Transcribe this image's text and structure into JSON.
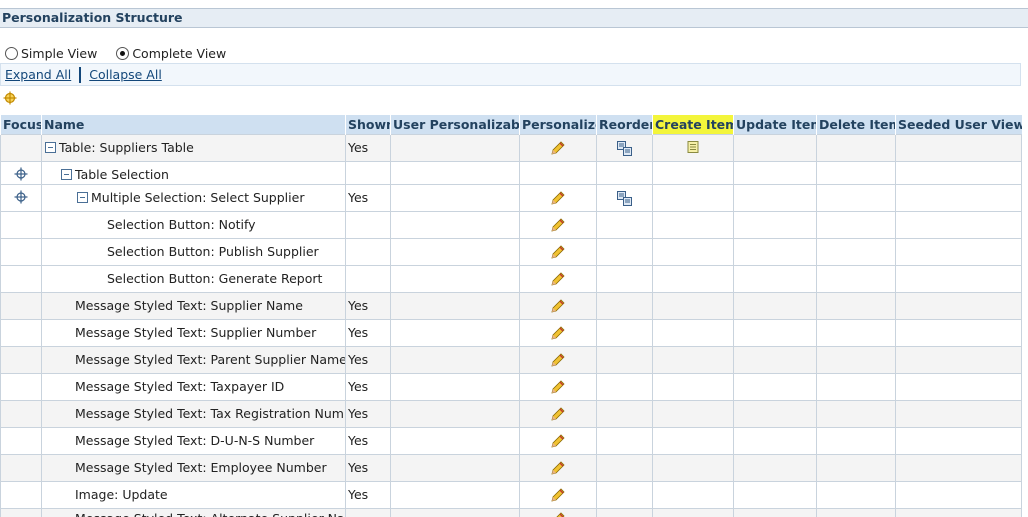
{
  "header": {
    "title": "Personalization Structure"
  },
  "view_options": {
    "simple_label": "Simple View",
    "complete_label": "Complete View",
    "selected": "Complete View"
  },
  "expand": {
    "expand_all": "Expand All",
    "collapse_all": "Collapse All"
  },
  "columns": {
    "focus": "Focus",
    "name": "Name",
    "shown": "Shown",
    "user_personalizable": "User Personalizable",
    "personalize": "Personalize",
    "reorder": "Reorder",
    "create_item": "Create Item",
    "update_item": "Update Item",
    "delete_item": "Delete Item",
    "seeded_user_views": "Seeded User Views"
  },
  "rows": [
    {
      "name": "Table: Suppliers Table",
      "shown": "Yes",
      "focus": false,
      "collapsible": true,
      "indent": 0,
      "personalize": true,
      "reorder": true,
      "create": true
    },
    {
      "name": "Table Selection",
      "shown": "",
      "focus": true,
      "collapsible": true,
      "indent": 1,
      "personalize": false,
      "reorder": false,
      "create": false
    },
    {
      "name": "Multiple Selection: Select Supplier",
      "shown": "Yes",
      "focus": true,
      "collapsible": true,
      "indent": 2,
      "personalize": true,
      "reorder": true,
      "create": false
    },
    {
      "name": "Selection Button: Notify",
      "shown": "",
      "focus": false,
      "collapsible": false,
      "indent": 3,
      "personalize": true,
      "reorder": false,
      "create": false
    },
    {
      "name": "Selection Button: Publish Supplier",
      "shown": "",
      "focus": false,
      "collapsible": false,
      "indent": 3,
      "personalize": true,
      "reorder": false,
      "create": false
    },
    {
      "name": "Selection Button: Generate Report",
      "shown": "",
      "focus": false,
      "collapsible": false,
      "indent": 3,
      "personalize": true,
      "reorder": false,
      "create": false
    },
    {
      "name": "Message Styled Text: Supplier Name",
      "shown": "Yes",
      "focus": false,
      "collapsible": false,
      "indent": 2,
      "personalize": true,
      "reorder": false,
      "create": false
    },
    {
      "name": "Message Styled Text: Supplier Number",
      "shown": "Yes",
      "focus": false,
      "collapsible": false,
      "indent": 2,
      "personalize": true,
      "reorder": false,
      "create": false
    },
    {
      "name": "Message Styled Text: Parent Supplier Name",
      "shown": "Yes",
      "focus": false,
      "collapsible": false,
      "indent": 2,
      "personalize": true,
      "reorder": false,
      "create": false
    },
    {
      "name": "Message Styled Text: Taxpayer ID",
      "shown": "Yes",
      "focus": false,
      "collapsible": false,
      "indent": 2,
      "personalize": true,
      "reorder": false,
      "create": false
    },
    {
      "name": "Message Styled Text: Tax Registration Number",
      "shown": "Yes",
      "focus": false,
      "collapsible": false,
      "indent": 2,
      "personalize": true,
      "reorder": false,
      "create": false
    },
    {
      "name": "Message Styled Text: D-U-N-S Number",
      "shown": "Yes",
      "focus": false,
      "collapsible": false,
      "indent": 2,
      "personalize": true,
      "reorder": false,
      "create": false
    },
    {
      "name": "Message Styled Text: Employee Number",
      "shown": "Yes",
      "focus": false,
      "collapsible": false,
      "indent": 2,
      "personalize": true,
      "reorder": false,
      "create": false
    },
    {
      "name": "Image: Update",
      "shown": "Yes",
      "focus": false,
      "collapsible": false,
      "indent": 2,
      "personalize": true,
      "reorder": false,
      "create": false
    },
    {
      "name": "Message Styled Text: Alternate Supplier Name",
      "shown": "",
      "focus": false,
      "collapsible": false,
      "indent": 2,
      "personalize": true,
      "reorder": false,
      "create": false
    }
  ],
  "colors": {
    "header_bg": "#e6edf4",
    "column_header_bg": "#cfe0f1",
    "highlight": "#f3f53b",
    "link": "#13477a"
  }
}
